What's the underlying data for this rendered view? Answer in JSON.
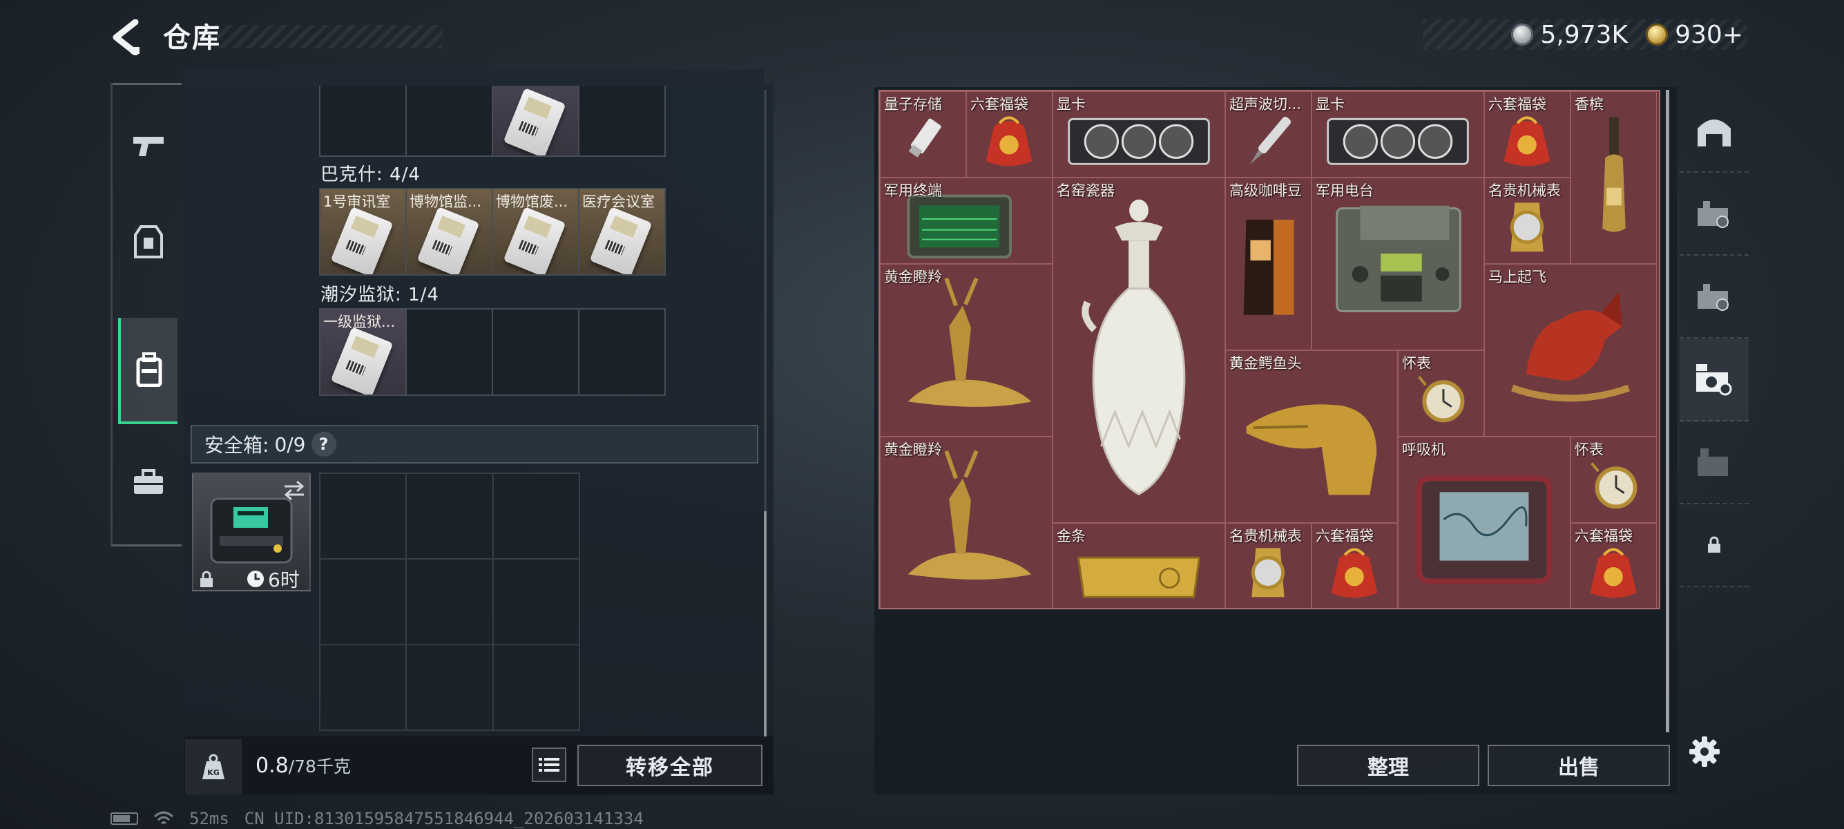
{
  "header": {
    "title": "仓库",
    "currencies": [
      {
        "icon": "silver-coin-icon",
        "value": "5,973K"
      },
      {
        "icon": "gold-coin-icon",
        "value": "930+"
      }
    ]
  },
  "left_rail": {
    "items": [
      {
        "icon": "gun-icon",
        "active": false
      },
      {
        "icon": "armor-vest-icon",
        "active": false
      },
      {
        "icon": "backpack-icon",
        "active": true
      },
      {
        "icon": "briefcase-icon",
        "active": false
      }
    ]
  },
  "containers": {
    "keycard_sections": [
      {
        "title": "",
        "cells": [
          "",
          "",
          "",
          ""
        ]
      },
      {
        "title": "巴克什: 4/4",
        "cells": [
          "1号审讯室",
          "博物馆监...",
          "博物馆废...",
          "医疗会议室"
        ]
      },
      {
        "title": "潮汐监狱: 1/4",
        "cells": [
          "一级监狱...",
          "",
          "",
          ""
        ]
      }
    ],
    "safebox": {
      "label": "安全箱:",
      "count": "0/9",
      "help": "?",
      "timer": "6时"
    }
  },
  "bottom_bar": {
    "weight_current": "0.8",
    "weight_max": "/78千克",
    "transfer_label": "转移全部"
  },
  "stash": {
    "items": [
      {
        "label": "量子存储"
      },
      {
        "label": "六套福袋"
      },
      {
        "label": "显卡"
      },
      {
        "label": "超声波切..."
      },
      {
        "label": "显卡"
      },
      {
        "label": "六套福袋"
      },
      {
        "label": "香槟"
      },
      {
        "label": "军用终端"
      },
      {
        "label": "名窑瓷器"
      },
      {
        "label": "高级咖啡豆"
      },
      {
        "label": "军用电台"
      },
      {
        "label": "名贵机械表"
      },
      {
        "label": "黄金瞪羚"
      },
      {
        "label": "马上起飞"
      },
      {
        "label": "黄金鳄鱼头"
      },
      {
        "label": "怀表"
      },
      {
        "label": "黄金瞪羚"
      },
      {
        "label": "呼吸机"
      },
      {
        "label": "怀表"
      },
      {
        "label": "金条"
      },
      {
        "label": "名贵机械表"
      },
      {
        "label": "六套福袋"
      },
      {
        "label": "六套福袋"
      }
    ],
    "sort_label": "整理",
    "sell_label": "出售"
  },
  "right_rail": {
    "tabs": [
      "stash-main-icon",
      "stash-tab-2-icon",
      "stash-tab-3-icon",
      "stash-tab-4-icon",
      "stash-tab-5-icon",
      "lock-icon"
    ]
  },
  "status": {
    "ping": "52ms",
    "uid": "CN UID:813015958475518469​44_202603141334"
  }
}
